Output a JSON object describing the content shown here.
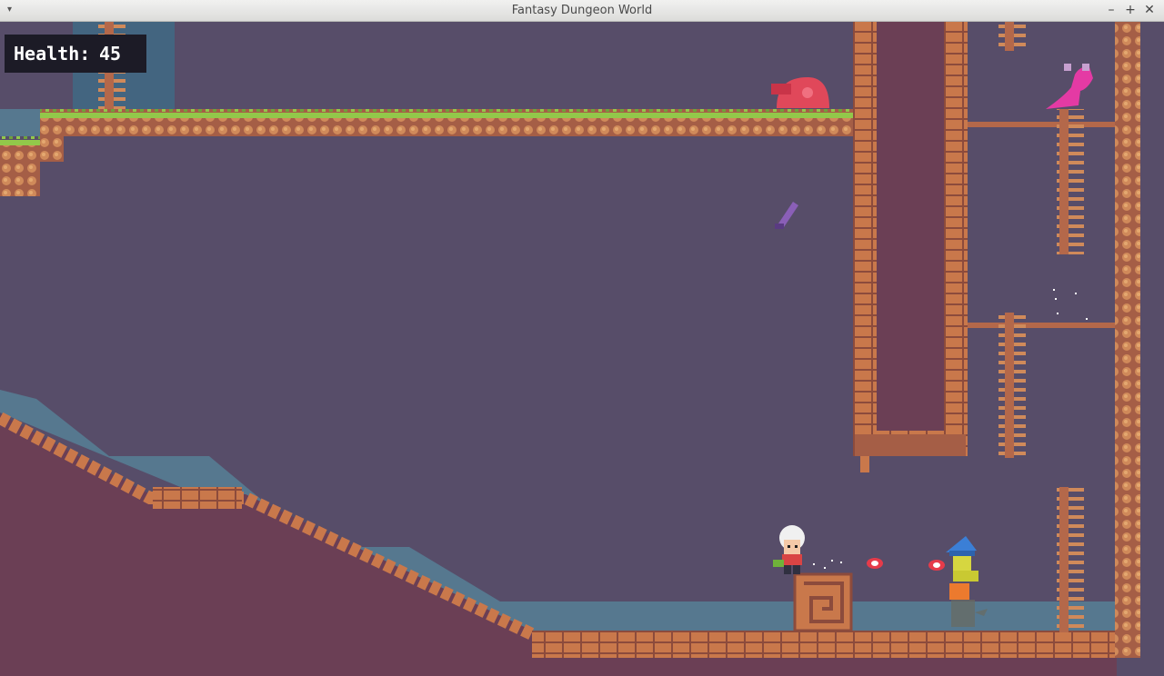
{
  "window": {
    "title": "Fantasy Dungeon World",
    "controls": {
      "minimize": "–",
      "maximize": "+",
      "close": "✕",
      "menu": "▾"
    }
  },
  "hud": {
    "health_label": "Health:",
    "health_value": "45"
  },
  "colors": {
    "sky": "#574d69",
    "earth": "#6b3f55",
    "brick": "#c9784b",
    "brick_dark": "#8c4b3c",
    "grass": "#92c84a",
    "water": "#56788f",
    "ladder": "#b4684a"
  },
  "sprites": {
    "player": "white-haired-hero",
    "enemy": "blue-hat-goblin-wizard",
    "mount": "orange-lizard",
    "dragon": "pink-dragon",
    "snail": "red-snail",
    "item": "purple-sword"
  }
}
